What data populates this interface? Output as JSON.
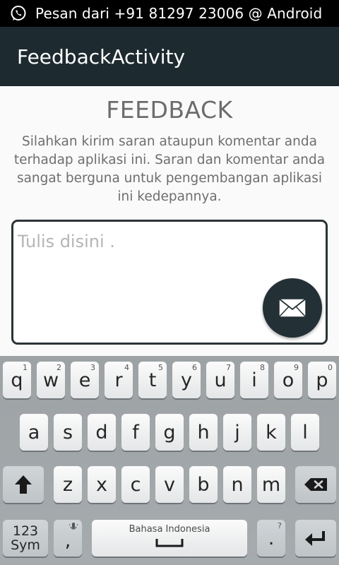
{
  "status_bar": {
    "notification_icon": "whatsapp-icon",
    "text": "Pesan dari +91 81297 23006 @ Android"
  },
  "action_bar": {
    "title": "FeedbackActivity"
  },
  "main": {
    "title": "FEEDBACK",
    "description": "Silahkan kirim saran ataupun komentar anda terhadap aplikasi ini. Saran dan komentar anda sangat berguna untuk pengembangan aplikasi ini kedepannya.",
    "feedback_input": {
      "placeholder": "Tulis disini .",
      "value": ""
    },
    "send_button_icon": "envelope-icon"
  },
  "keyboard": {
    "row1": [
      {
        "key": "q",
        "hint": "1"
      },
      {
        "key": "w",
        "hint": "2"
      },
      {
        "key": "e",
        "hint": "3"
      },
      {
        "key": "r",
        "hint": "4"
      },
      {
        "key": "t",
        "hint": "5"
      },
      {
        "key": "y",
        "hint": "6"
      },
      {
        "key": "u",
        "hint": "7"
      },
      {
        "key": "i",
        "hint": "8"
      },
      {
        "key": "o",
        "hint": "9"
      },
      {
        "key": "p",
        "hint": "0"
      }
    ],
    "row2": [
      "a",
      "s",
      "d",
      "f",
      "g",
      "h",
      "j",
      "k",
      "l"
    ],
    "row3": [
      "z",
      "x",
      "c",
      "v",
      "b",
      "n",
      "m"
    ],
    "shift_icon": "shift-arrow-icon",
    "backspace_icon": "backspace-icon",
    "sym_top": "123",
    "sym_bottom": "Sym",
    "comma": ",",
    "comma_icon": "microphone-icon",
    "space_label": "Bahasa Indonesia",
    "period": ".",
    "period_hint": "?",
    "enter_icon": "enter-arrow-icon"
  },
  "colors": {
    "action_bar": "#1d2a2f",
    "accent_dark": "#233036",
    "keyboard_bg": "#a1a6a9"
  }
}
